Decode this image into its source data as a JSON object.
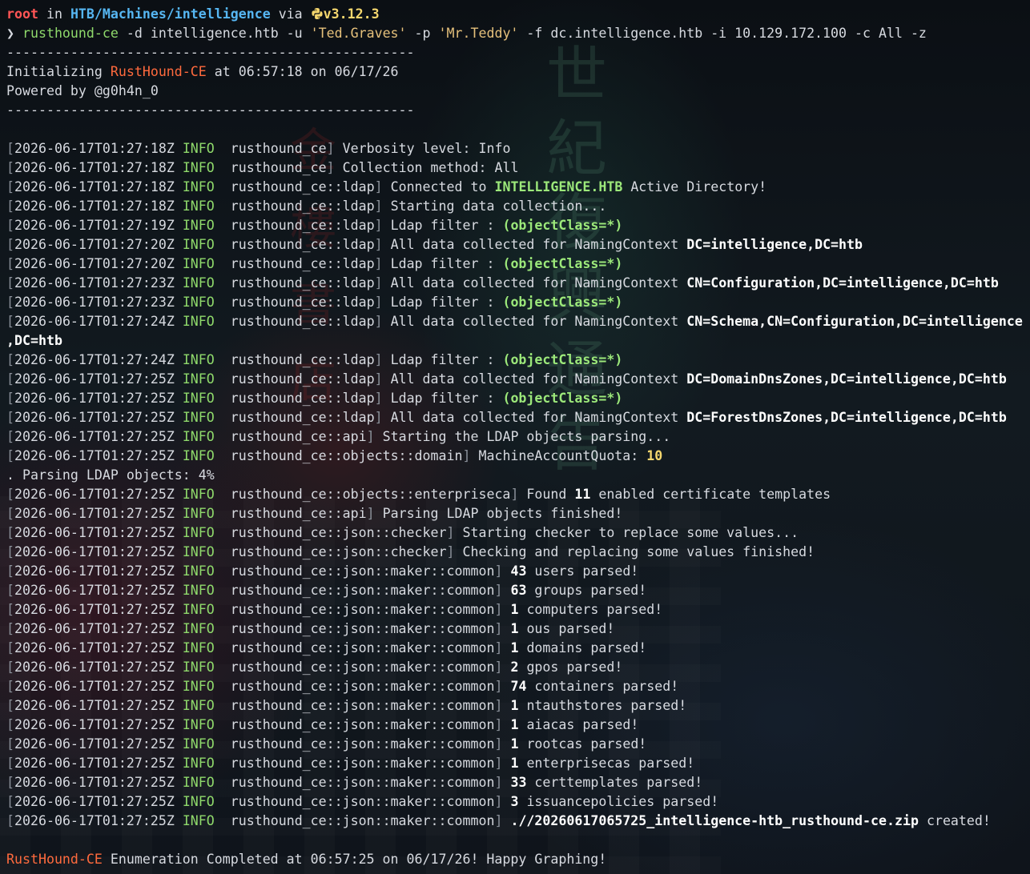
{
  "prompt": {
    "user": "root",
    "in_word": " in ",
    "path": "HTB/Machines/intelligence",
    "via_word": " via ",
    "python_icon": "python-icon",
    "python_version": "v3.12.3",
    "symbol": "❯ ",
    "command": "rusthound-ce",
    "args_1": " -d intelligence.htb -u ",
    "user_arg": "'Ted.Graves'",
    "args_2": " -p ",
    "pass_arg": "'Mr.Teddy'",
    "args_3": " -f dc.intelligence.htb -i 10.129.172.100 -c All -z"
  },
  "banner": {
    "separator": "---------------------------------------------------",
    "init_prefix": "Initializing ",
    "tool_name": "RustHound-CE",
    "init_suffix": " at 06:57:18 on 06/17/26",
    "powered_by": "Powered by @g0h4n_0"
  },
  "log": [
    {
      "ts": "2026-06-17T01:27:18Z",
      "level": "INFO",
      "module": "rusthound_ce",
      "parts": [
        {
          "t": " Verbosity level: Info",
          "s": "plain"
        }
      ]
    },
    {
      "ts": "2026-06-17T01:27:18Z",
      "level": "INFO",
      "module": "rusthound_ce",
      "parts": [
        {
          "t": " Collection method: All",
          "s": "plain"
        }
      ]
    },
    {
      "ts": "2026-06-17T01:27:18Z",
      "level": "INFO",
      "module": "rusthound_ce::ldap",
      "parts": [
        {
          "t": " Connected to ",
          "s": "plain"
        },
        {
          "t": "INTELLIGENCE.HTB",
          "s": "green"
        },
        {
          "t": " Active Directory!",
          "s": "plain"
        }
      ]
    },
    {
      "ts": "2026-06-17T01:27:18Z",
      "level": "INFO",
      "module": "rusthound_ce::ldap",
      "parts": [
        {
          "t": " Starting data collection...",
          "s": "plain"
        }
      ]
    },
    {
      "ts": "2026-06-17T01:27:19Z",
      "level": "INFO",
      "module": "rusthound_ce::ldap",
      "parts": [
        {
          "t": " Ldap filter : ",
          "s": "plain"
        },
        {
          "t": "(objectClass=*)",
          "s": "green"
        }
      ]
    },
    {
      "ts": "2026-06-17T01:27:20Z",
      "level": "INFO",
      "module": "rusthound_ce::ldap",
      "parts": [
        {
          "t": " All data collected for NamingContext ",
          "s": "plain"
        },
        {
          "t": "DC=intelligence,DC=htb",
          "s": "bold"
        }
      ]
    },
    {
      "ts": "2026-06-17T01:27:20Z",
      "level": "INFO",
      "module": "rusthound_ce::ldap",
      "parts": [
        {
          "t": " Ldap filter : ",
          "s": "plain"
        },
        {
          "t": "(objectClass=*)",
          "s": "green"
        }
      ]
    },
    {
      "ts": "2026-06-17T01:27:23Z",
      "level": "INFO",
      "module": "rusthound_ce::ldap",
      "parts": [
        {
          "t": " All data collected for NamingContext ",
          "s": "plain"
        },
        {
          "t": "CN=Configuration,DC=intelligence,DC=htb",
          "s": "bold"
        }
      ]
    },
    {
      "ts": "2026-06-17T01:27:23Z",
      "level": "INFO",
      "module": "rusthound_ce::ldap",
      "parts": [
        {
          "t": " Ldap filter : ",
          "s": "plain"
        },
        {
          "t": "(objectClass=*)",
          "s": "green"
        }
      ]
    },
    {
      "ts": "2026-06-17T01:27:24Z",
      "level": "INFO",
      "module": "rusthound_ce::ldap",
      "parts": [
        {
          "t": " All data collected for NamingContext ",
          "s": "plain"
        },
        {
          "t": "CN=Schema,CN=Configuration,DC=intelligence",
          "s": "bold"
        }
      ],
      "wrap": ",DC=htb"
    },
    {
      "ts": "2026-06-17T01:27:24Z",
      "level": "INFO",
      "module": "rusthound_ce::ldap",
      "parts": [
        {
          "t": " Ldap filter : ",
          "s": "plain"
        },
        {
          "t": "(objectClass=*)",
          "s": "green"
        }
      ]
    },
    {
      "ts": "2026-06-17T01:27:25Z",
      "level": "INFO",
      "module": "rusthound_ce::ldap",
      "parts": [
        {
          "t": " All data collected for NamingContext ",
          "s": "plain"
        },
        {
          "t": "DC=DomainDnsZones,DC=intelligence,DC=htb",
          "s": "bold"
        }
      ]
    },
    {
      "ts": "2026-06-17T01:27:25Z",
      "level": "INFO",
      "module": "rusthound_ce::ldap",
      "parts": [
        {
          "t": " Ldap filter : ",
          "s": "plain"
        },
        {
          "t": "(objectClass=*)",
          "s": "green"
        }
      ]
    },
    {
      "ts": "2026-06-17T01:27:25Z",
      "level": "INFO",
      "module": "rusthound_ce::ldap",
      "parts": [
        {
          "t": " All data collected for NamingContext ",
          "s": "plain"
        },
        {
          "t": "DC=ForestDnsZones,DC=intelligence,DC=htb",
          "s": "bold"
        }
      ]
    },
    {
      "ts": "2026-06-17T01:27:25Z",
      "level": "INFO",
      "module": "rusthound_ce::api",
      "parts": [
        {
          "t": " Starting the LDAP objects parsing...",
          "s": "plain"
        }
      ]
    },
    {
      "ts": "2026-06-17T01:27:25Z",
      "level": "INFO",
      "module": "rusthound_ce::objects::domain",
      "parts": [
        {
          "t": " MachineAccountQuota: ",
          "s": "plain"
        },
        {
          "t": "10",
          "s": "yellow"
        }
      ]
    },
    {
      "raw": ". Parsing LDAP objects: 4%"
    },
    {
      "ts": "2026-06-17T01:27:25Z",
      "level": "INFO",
      "module": "rusthound_ce::objects::enterpriseca",
      "parts": [
        {
          "t": " Found ",
          "s": "plain"
        },
        {
          "t": "11",
          "s": "bold"
        },
        {
          "t": " enabled certificate templates",
          "s": "plain"
        }
      ]
    },
    {
      "ts": "2026-06-17T01:27:25Z",
      "level": "INFO",
      "module": "rusthound_ce::api",
      "parts": [
        {
          "t": " Parsing LDAP objects finished!",
          "s": "plain"
        }
      ]
    },
    {
      "ts": "2026-06-17T01:27:25Z",
      "level": "INFO",
      "module": "rusthound_ce::json::checker",
      "parts": [
        {
          "t": " Starting checker to replace some values...",
          "s": "plain"
        }
      ]
    },
    {
      "ts": "2026-06-17T01:27:25Z",
      "level": "INFO",
      "module": "rusthound_ce::json::checker",
      "parts": [
        {
          "t": " Checking and replacing some values finished!",
          "s": "plain"
        }
      ]
    },
    {
      "ts": "2026-06-17T01:27:25Z",
      "level": "INFO",
      "module": "rusthound_ce::json::maker::common",
      "parts": [
        {
          "t": " ",
          "s": "plain"
        },
        {
          "t": "43",
          "s": "bold"
        },
        {
          "t": " users parsed!",
          "s": "plain"
        }
      ]
    },
    {
      "ts": "2026-06-17T01:27:25Z",
      "level": "INFO",
      "module": "rusthound_ce::json::maker::common",
      "parts": [
        {
          "t": " ",
          "s": "plain"
        },
        {
          "t": "63",
          "s": "bold"
        },
        {
          "t": " groups parsed!",
          "s": "plain"
        }
      ]
    },
    {
      "ts": "2026-06-17T01:27:25Z",
      "level": "INFO",
      "module": "rusthound_ce::json::maker::common",
      "parts": [
        {
          "t": " ",
          "s": "plain"
        },
        {
          "t": "1",
          "s": "bold"
        },
        {
          "t": " computers parsed!",
          "s": "plain"
        }
      ]
    },
    {
      "ts": "2026-06-17T01:27:25Z",
      "level": "INFO",
      "module": "rusthound_ce::json::maker::common",
      "parts": [
        {
          "t": " ",
          "s": "plain"
        },
        {
          "t": "1",
          "s": "bold"
        },
        {
          "t": " ous parsed!",
          "s": "plain"
        }
      ]
    },
    {
      "ts": "2026-06-17T01:27:25Z",
      "level": "INFO",
      "module": "rusthound_ce::json::maker::common",
      "parts": [
        {
          "t": " ",
          "s": "plain"
        },
        {
          "t": "1",
          "s": "bold"
        },
        {
          "t": " domains parsed!",
          "s": "plain"
        }
      ]
    },
    {
      "ts": "2026-06-17T01:27:25Z",
      "level": "INFO",
      "module": "rusthound_ce::json::maker::common",
      "parts": [
        {
          "t": " ",
          "s": "plain"
        },
        {
          "t": "2",
          "s": "bold"
        },
        {
          "t": " gpos parsed!",
          "s": "plain"
        }
      ]
    },
    {
      "ts": "2026-06-17T01:27:25Z",
      "level": "INFO",
      "module": "rusthound_ce::json::maker::common",
      "parts": [
        {
          "t": " ",
          "s": "plain"
        },
        {
          "t": "74",
          "s": "bold"
        },
        {
          "t": " containers parsed!",
          "s": "plain"
        }
      ]
    },
    {
      "ts": "2026-06-17T01:27:25Z",
      "level": "INFO",
      "module": "rusthound_ce::json::maker::common",
      "parts": [
        {
          "t": " ",
          "s": "plain"
        },
        {
          "t": "1",
          "s": "bold"
        },
        {
          "t": " ntauthstores parsed!",
          "s": "plain"
        }
      ]
    },
    {
      "ts": "2026-06-17T01:27:25Z",
      "level": "INFO",
      "module": "rusthound_ce::json::maker::common",
      "parts": [
        {
          "t": " ",
          "s": "plain"
        },
        {
          "t": "1",
          "s": "bold"
        },
        {
          "t": " aiacas parsed!",
          "s": "plain"
        }
      ]
    },
    {
      "ts": "2026-06-17T01:27:25Z",
      "level": "INFO",
      "module": "rusthound_ce::json::maker::common",
      "parts": [
        {
          "t": " ",
          "s": "plain"
        },
        {
          "t": "1",
          "s": "bold"
        },
        {
          "t": " rootcas parsed!",
          "s": "plain"
        }
      ]
    },
    {
      "ts": "2026-06-17T01:27:25Z",
      "level": "INFO",
      "module": "rusthound_ce::json::maker::common",
      "parts": [
        {
          "t": " ",
          "s": "plain"
        },
        {
          "t": "1",
          "s": "bold"
        },
        {
          "t": " enterprisecas parsed!",
          "s": "plain"
        }
      ]
    },
    {
      "ts": "2026-06-17T01:27:25Z",
      "level": "INFO",
      "module": "rusthound_ce::json::maker::common",
      "parts": [
        {
          "t": " ",
          "s": "plain"
        },
        {
          "t": "33",
          "s": "bold"
        },
        {
          "t": " certtemplates parsed!",
          "s": "plain"
        }
      ]
    },
    {
      "ts": "2026-06-17T01:27:25Z",
      "level": "INFO",
      "module": "rusthound_ce::json::maker::common",
      "parts": [
        {
          "t": " ",
          "s": "plain"
        },
        {
          "t": "3",
          "s": "bold"
        },
        {
          "t": " issuancepolicies parsed!",
          "s": "plain"
        }
      ]
    },
    {
      "ts": "2026-06-17T01:27:25Z",
      "level": "INFO",
      "module": "rusthound_ce::json::maker::common",
      "parts": [
        {
          "t": " ",
          "s": "plain"
        },
        {
          "t": ".//20260617065725_intelligence-htb_rusthound-ce.zip",
          "s": "bold"
        },
        {
          "t": " created!",
          "s": "plain"
        }
      ]
    }
  ],
  "footer": {
    "tool_name": "RustHound-CE",
    "message": " Enumeration Completed at 06:57:25 on 06/17/26! Happy Graphing!"
  },
  "colors": {
    "background": "#0d1116",
    "root": "#ff5555",
    "path": "#56b6f2",
    "python": "#f5d76e",
    "command": "#8fd96b",
    "string_arg": "#e5c07b",
    "brand": "#ff6a3d",
    "info": "#8fd96b"
  }
}
